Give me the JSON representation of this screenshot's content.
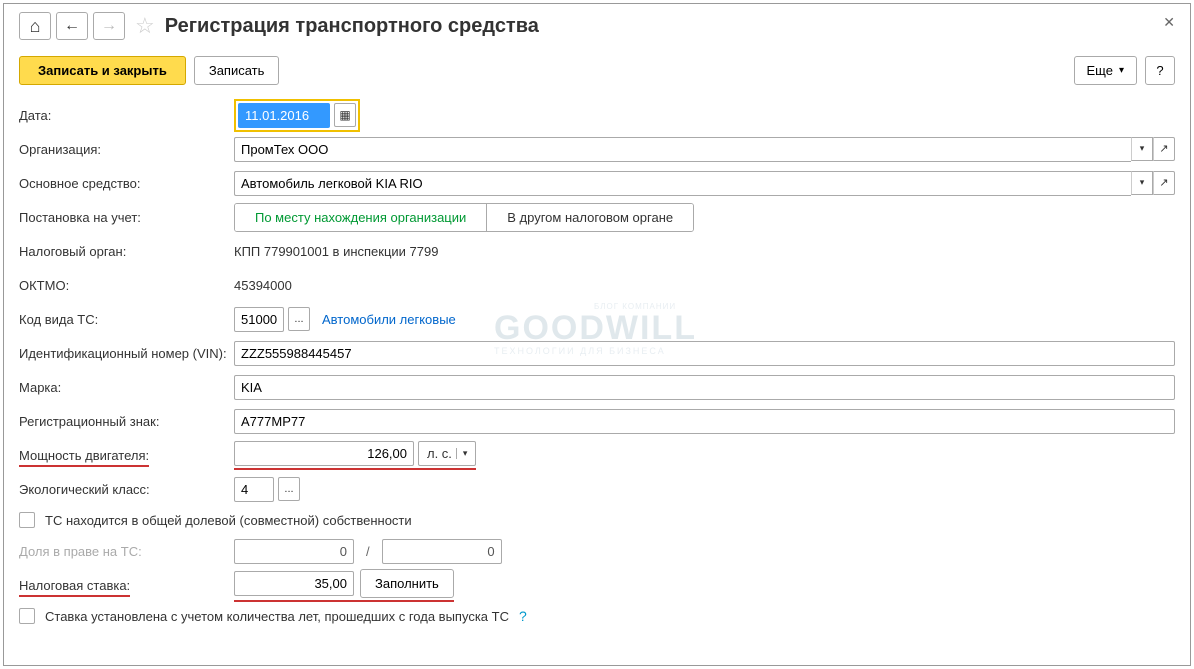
{
  "title": "Регистрация транспортного средства",
  "toolbar": {
    "save_close": "Записать и закрыть",
    "save": "Записать",
    "more": "Еще",
    "help": "?"
  },
  "labels": {
    "date": "Дата:",
    "org": "Организация:",
    "asset": "Основное средство:",
    "registration": "Постановка на учет:",
    "tax_office": "Налоговый орган:",
    "oktmo": "ОКТМО:",
    "vehicle_code": "Код вида ТС:",
    "vin": "Идентификационный номер (VIN):",
    "brand": "Марка:",
    "reg_plate": "Регистрационный знак:",
    "engine_power": "Мощность двигателя:",
    "eco_class": "Экологический класс:",
    "share": "Доля в праве на ТС:",
    "tax_rate": "Налоговая ставка:"
  },
  "values": {
    "date": "11.01.2016",
    "org": "ПромТех ООО",
    "asset": "Автомобиль легковой KIA RIO",
    "tax_office": "КПП 779901001 в инспекции 7799",
    "oktmo": "45394000",
    "vehicle_code": "51000",
    "vehicle_code_link": "Автомобили легковые",
    "vin": "ZZZ555988445457",
    "brand": "KIA",
    "reg_plate": "А777МР77",
    "engine_power": "126,00",
    "engine_unit": "л. с.",
    "eco_class": "4",
    "share_1": "0",
    "share_2": "0",
    "tax_rate": "35,00"
  },
  "toggles": {
    "by_org_location": "По месту нахождения организации",
    "other_tax": "В другом налоговом органе"
  },
  "checkboxes": {
    "shared_ownership": "ТС находится в общей долевой (совместной) собственности",
    "rate_by_age": "Ставка установлена с учетом количества лет, прошедших с года выпуска ТС"
  },
  "buttons": {
    "fill": "Заполнить"
  },
  "watermark": "GOODWILL",
  "watermark_sub": "ТЕХНОЛОГИИ ДЛЯ БИЗНЕСА",
  "watermark_top": "БЛОГ КОМПАНИИ"
}
